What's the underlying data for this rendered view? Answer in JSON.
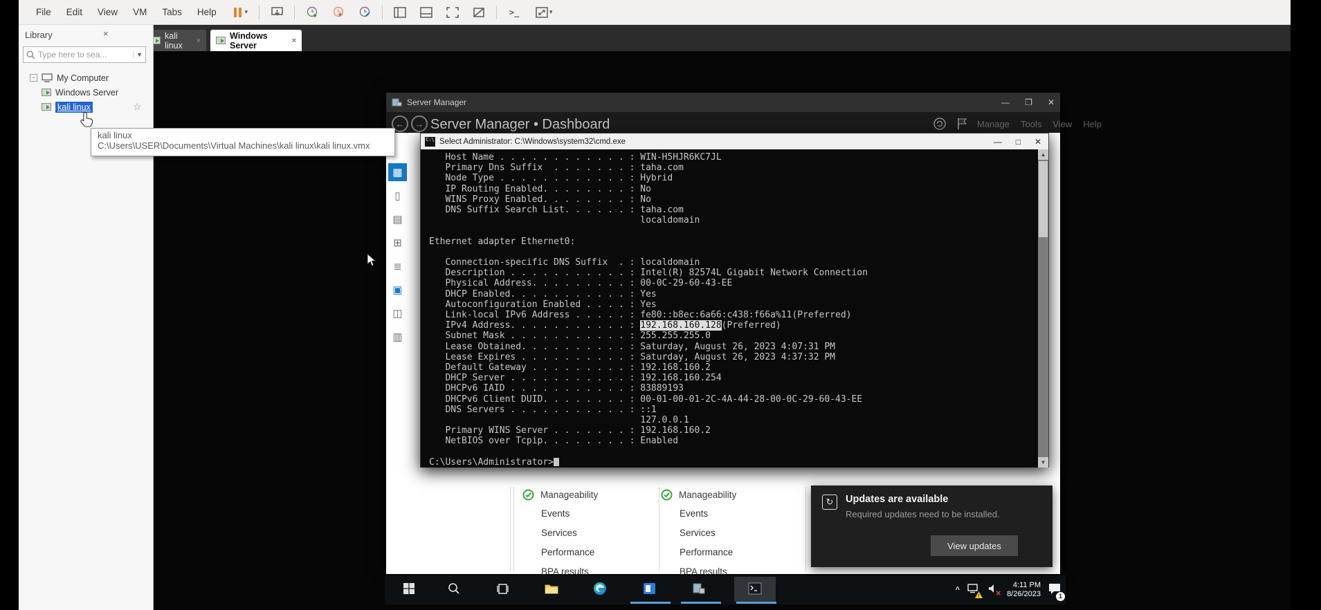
{
  "menu": {
    "items": [
      "File",
      "Edit",
      "View",
      "VM",
      "Tabs",
      "Help"
    ]
  },
  "toolbar": {
    "icons": [
      "pause-button",
      "send-ctrl-alt-del",
      "take-snapshot",
      "revert-snapshot",
      "manage-snapshots",
      "show-library-panel",
      "show-thumbnail-bar",
      "enter-full-screen",
      "unity-mode",
      "open-console",
      "fit-guest-now"
    ]
  },
  "tabs": {
    "items": [
      {
        "label": "kali linux",
        "active": false
      },
      {
        "label": "Windows Server",
        "active": true
      }
    ],
    "close_glyph": "×"
  },
  "library": {
    "title": "Library",
    "close_glyph": "×",
    "search_placeholder": "Type here to sea...",
    "tree": {
      "root": "My Computer",
      "vms": [
        "Windows Server",
        "kali linux"
      ],
      "selected": "kali linux"
    },
    "tooltip": {
      "name": "kali linux",
      "path": "C:\\Users\\USER\\Documents\\Virtual Machines\\kali linux\\kali linux.vmx"
    }
  },
  "server_manager": {
    "title": "Server Manager",
    "breadcrumb": "Server Manager • Dashboard",
    "menu": [
      "Manage",
      "Tools",
      "View",
      "Help"
    ],
    "window_buttons": {
      "minimize": "—",
      "maximize": "❐",
      "close": "✕"
    },
    "dashboard": {
      "groups": [
        {
          "status_ok": "Manageability",
          "rows": [
            "Events",
            "Services",
            "Performance",
            "BPA results"
          ]
        },
        {
          "status_ok": "Manageability",
          "rows": [
            "Events",
            "Services",
            "Performance",
            "BPA results"
          ]
        }
      ]
    }
  },
  "cmd": {
    "title": "Select Administrator: C:\\Windows\\system32\\cmd.exe",
    "window_buttons": {
      "minimize": "—",
      "maximize": "□",
      "close": "✕"
    },
    "lines": [
      "   Host Name . . . . . . . . . . . . : WIN-H5HJR6KC7JL",
      "   Primary Dns Suffix  . . . . . . . : taha.com",
      "   Node Type . . . . . . . . . . . . : Hybrid",
      "   IP Routing Enabled. . . . . . . . : No",
      "   WINS Proxy Enabled. . . . . . . . : No",
      "   DNS Suffix Search List. . . . . . : taha.com",
      "                                       localdomain",
      "",
      "Ethernet adapter Ethernet0:",
      "",
      "   Connection-specific DNS Suffix  . : localdomain",
      "   Description . . . . . . . . . . . : Intel(R) 82574L Gigabit Network Connection",
      "   Physical Address. . . . . . . . . : 00-0C-29-60-43-EE",
      "   DHCP Enabled. . . . . . . . . . . : Yes",
      "   Autoconfiguration Enabled . . . . : Yes",
      "   Link-local IPv6 Address . . . . . : fe80::b8ec:6a66:c438:f66a%11(Preferred)",
      {
        "pre": "   IPv4 Address. . . . . . . . . . . : ",
        "highlight": "192.168.160.128",
        "post": "(Preferred)"
      },
      "   Subnet Mask . . . . . . . . . . . : 255.255.255.0",
      "   Lease Obtained. . . . . . . . . . : Saturday, August 26, 2023 4:07:31 PM",
      "   Lease Expires . . . . . . . . . . : Saturday, August 26, 2023 4:37:32 PM",
      "   Default Gateway . . . . . . . . . : 192.168.160.2",
      "   DHCP Server . . . . . . . . . . . : 192.168.160.254",
      "   DHCPv6 IAID . . . . . . . . . . . : 83889193",
      "   DHCPv6 Client DUID. . . . . . . . : 00-01-00-01-2C-4A-44-28-00-0C-29-60-43-EE",
      "   DNS Servers . . . . . . . . . . . : ::1",
      "                                       127.0.0.1",
      "   Primary WINS Server . . . . . . . : 192.168.160.2",
      "   NetBIOS over Tcpip. . . . . . . . : Enabled",
      ""
    ],
    "prompt": "C:\\Users\\Administrator>"
  },
  "notification": {
    "title": "Updates are available",
    "message": "Required updates need to be installed.",
    "action": "View updates"
  },
  "taskbar": {
    "icons": [
      "start",
      "search",
      "task-view",
      "file-explorer",
      "edge",
      "pinned-app",
      "server-manager",
      "command-prompt"
    ],
    "tray": {
      "time": "4:11 PM",
      "date": "8/26/2023",
      "badge_count": "1"
    }
  },
  "colors": {
    "selection_blue": "#2465d6",
    "accent_orange": "#e0862c",
    "dashboard_green": "#3aa63e",
    "taskbar_underline": "#5a9fd4",
    "sm_nav_selected": "#1779c4"
  }
}
